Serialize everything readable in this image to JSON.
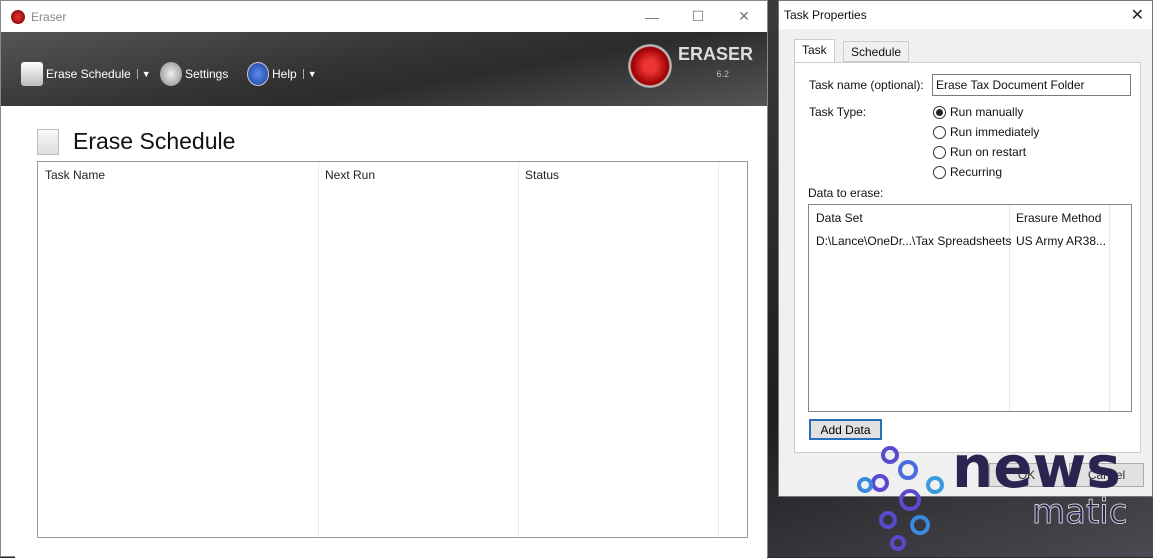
{
  "main_window": {
    "title": "Eraser",
    "controls": {
      "minimize": "—",
      "maximize": "☐",
      "close": "✕"
    },
    "toolbar": {
      "erase_schedule": "Erase Schedule",
      "settings": "Settings",
      "help": "Help",
      "dropdown": "▼"
    },
    "logo": {
      "name": "ERASER",
      "version": "6.2"
    },
    "page_title": "Erase Schedule",
    "table": {
      "columns": [
        "Task Name",
        "Next Run",
        "Status"
      ],
      "rows": []
    }
  },
  "dialog": {
    "title": "Task Properties",
    "close": "✕",
    "tabs": [
      {
        "label": "Task",
        "active": true
      },
      {
        "label": "Schedule",
        "active": false
      }
    ],
    "task_name_label": "Task name (optional):",
    "task_name_value": "Erase Tax Document Folder",
    "task_type_label": "Task Type:",
    "task_types": [
      {
        "label": "Run manually",
        "selected": true
      },
      {
        "label": "Run immediately",
        "selected": false
      },
      {
        "label": "Run on restart",
        "selected": false
      },
      {
        "label": "Recurring",
        "selected": false
      }
    ],
    "data_label": "Data to erase:",
    "data_columns": [
      "Data Set",
      "Erasure Method"
    ],
    "data_rows": [
      {
        "data_set": "D:\\Lance\\OneDr...\\Tax Spreadsheets",
        "method": "US Army AR38..."
      }
    ],
    "add_data": "Add Data",
    "ok": "OK",
    "cancel": "Cancel"
  },
  "watermark": {
    "text1": "news",
    "text2": "matic"
  }
}
